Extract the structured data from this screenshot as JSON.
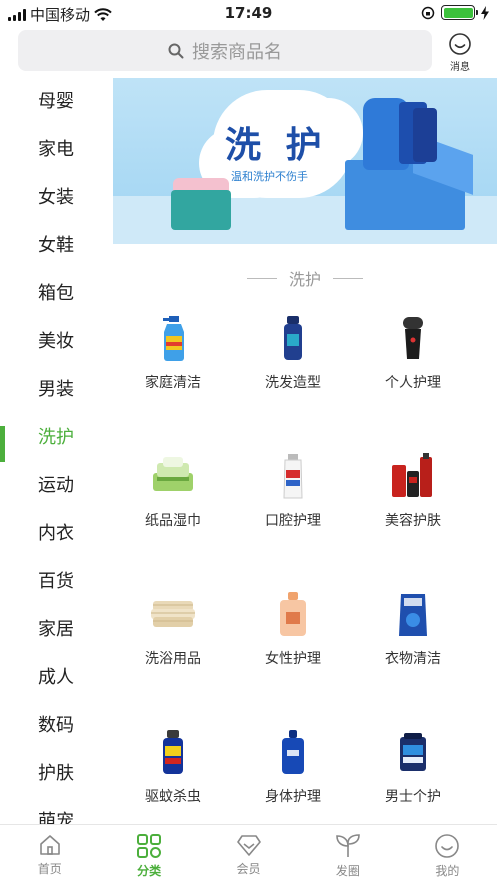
{
  "status_bar": {
    "carrier": "中国移动",
    "time": "17:49",
    "battery_level": 1.0
  },
  "search": {
    "placeholder": "搜索商品名"
  },
  "header": {
    "message_label": "消息"
  },
  "sidebar": {
    "items": [
      {
        "label": "母婴"
      },
      {
        "label": "家电"
      },
      {
        "label": "女装"
      },
      {
        "label": "女鞋"
      },
      {
        "label": "箱包"
      },
      {
        "label": "美妆"
      },
      {
        "label": "男装"
      },
      {
        "label": "洗护"
      },
      {
        "label": "运动"
      },
      {
        "label": "内衣"
      },
      {
        "label": "百货"
      },
      {
        "label": "家居"
      },
      {
        "label": "成人"
      },
      {
        "label": "数码"
      },
      {
        "label": "护肤"
      },
      {
        "label": "萌宠"
      }
    ],
    "active_label": "洗护"
  },
  "banner": {
    "title": "洗 护",
    "subtitle": "温和洗护不伤手"
  },
  "section": {
    "title": "洗护"
  },
  "categories": [
    {
      "label": "家庭清洁",
      "icon": "spray-bottle-icon"
    },
    {
      "label": "洗发造型",
      "icon": "shampoo-bottle-icon"
    },
    {
      "label": "个人护理",
      "icon": "shaver-icon"
    },
    {
      "label": "纸品湿巾",
      "icon": "tissue-pack-icon"
    },
    {
      "label": "口腔护理",
      "icon": "toothpaste-icon"
    },
    {
      "label": "美容护肤",
      "icon": "skincare-set-icon"
    },
    {
      "label": "洗浴用品",
      "icon": "towel-icon"
    },
    {
      "label": "女性护理",
      "icon": "feminine-care-bottle-icon"
    },
    {
      "label": "衣物清洁",
      "icon": "laundry-detergent-icon"
    },
    {
      "label": "驱蚊杀虫",
      "icon": "insect-spray-icon"
    },
    {
      "label": "身体护理",
      "icon": "body-lotion-icon"
    },
    {
      "label": "男士个护",
      "icon": "mens-facewash-icon"
    }
  ],
  "tabbar": {
    "tabs": [
      {
        "label": "首页",
        "icon": "home-icon"
      },
      {
        "label": "分类",
        "icon": "category-grid-icon"
      },
      {
        "label": "会员",
        "icon": "diamond-icon"
      },
      {
        "label": "发圈",
        "icon": "sprout-icon"
      },
      {
        "label": "我的",
        "icon": "smile-face-icon"
      }
    ],
    "active_label": "分类"
  },
  "colors": {
    "accent": "#4caf3c",
    "search_bg": "#efeff1",
    "banner_blue": "#1e4fa8"
  }
}
